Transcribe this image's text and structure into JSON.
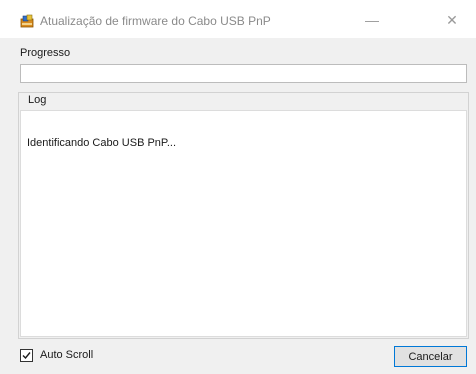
{
  "window": {
    "title": "Atualização de firmware do Cabo USB PnP",
    "app_icon": "installer-icon",
    "minimize_glyph": "—",
    "close_glyph": "✕"
  },
  "progress": {
    "label": "Progresso",
    "value_percent": 0,
    "fill_color": "#06b025"
  },
  "log": {
    "label": "Log",
    "text": "Identificando Cabo USB PnP..."
  },
  "footer": {
    "auto_scroll_label": "Auto Scroll",
    "auto_scroll_checked": true,
    "cancel_label": "Cancelar",
    "cancel_border_color": "#0078d7"
  }
}
